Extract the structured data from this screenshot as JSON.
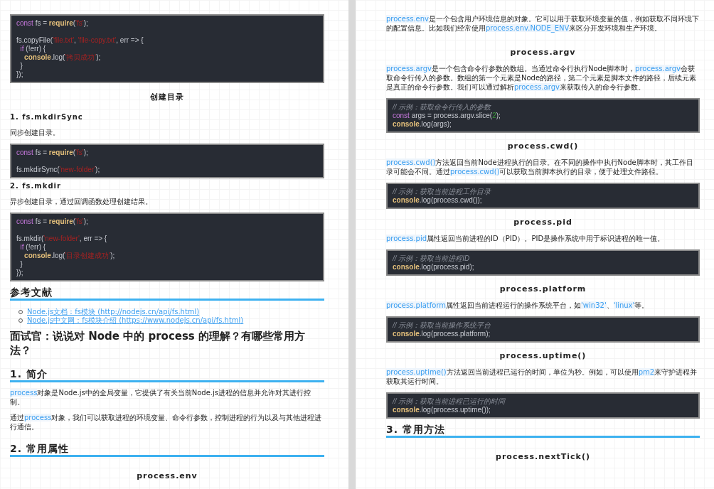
{
  "pages": [
    {
      "blocks": [
        {
          "kind": "code",
          "lines": [
            {
              "kind": "code",
              "tokens": [
                {
                  "kind": "kw",
                  "text": "const"
                },
                {
                  "kind": "plain",
                  "text": " fs = "
                },
                {
                  "kind": "fn",
                  "text": "require"
                },
                {
                  "kind": "plain",
                  "text": "("
                },
                {
                  "kind": "str",
                  "text": "'fs'"
                },
                {
                  "kind": "plain",
                  "text": ");"
                }
              ]
            },
            {
              "kind": "blank"
            },
            {
              "kind": "code",
              "tokens": [
                {
                  "kind": "plain",
                  "text": "fs.copyFile("
                },
                {
                  "kind": "str",
                  "text": "'file.txt'"
                },
                {
                  "kind": "plain",
                  "text": ", "
                },
                {
                  "kind": "str",
                  "text": "'file-copy.txt'"
                },
                {
                  "kind": "plain",
                  "text": ", err => {"
                }
              ]
            },
            {
              "kind": "code",
              "tokens": [
                {
                  "kind": "kw",
                  "text": "  if"
                },
                {
                  "kind": "plain",
                  "text": " (!err) {"
                }
              ]
            },
            {
              "kind": "code",
              "tokens": [
                {
                  "kind": "fn",
                  "text": "    console"
                },
                {
                  "kind": "plain",
                  "text": ".log("
                },
                {
                  "kind": "str",
                  "text": "'拷贝成功'"
                },
                {
                  "kind": "plain",
                  "text": ");"
                }
              ]
            },
            {
              "kind": "code",
              "tokens": [
                {
                  "kind": "plain",
                  "text": "  }"
                }
              ]
            },
            {
              "kind": "code",
              "tokens": [
                {
                  "kind": "plain",
                  "text": "});"
                }
              ]
            }
          ]
        },
        {
          "kind": "title",
          "text": "创建目录"
        },
        {
          "kind": "h4",
          "text": "1. fs.mkdirSync"
        },
        {
          "kind": "para",
          "segments": [
            {
              "kind": "text",
              "text": "同步创建目录。"
            }
          ]
        },
        {
          "kind": "code",
          "lines": [
            {
              "kind": "code",
              "tokens": [
                {
                  "kind": "kw",
                  "text": "const"
                },
                {
                  "kind": "plain",
                  "text": " fs = "
                },
                {
                  "kind": "fn",
                  "text": "require"
                },
                {
                  "kind": "plain",
                  "text": "("
                },
                {
                  "kind": "str",
                  "text": "'fs'"
                },
                {
                  "kind": "plain",
                  "text": ");"
                }
              ]
            },
            {
              "kind": "blank"
            },
            {
              "kind": "code",
              "tokens": [
                {
                  "kind": "plain",
                  "text": "fs.mkdirSync("
                },
                {
                  "kind": "str",
                  "text": "'new-folder'"
                },
                {
                  "kind": "plain",
                  "text": ");"
                }
              ]
            }
          ]
        },
        {
          "kind": "h4",
          "text": "2. fs.mkdir"
        },
        {
          "kind": "para",
          "segments": [
            {
              "kind": "text",
              "text": "异步创建目录，通过回调函数处理创建结果。"
            }
          ]
        },
        {
          "kind": "code",
          "lines": [
            {
              "kind": "code",
              "tokens": [
                {
                  "kind": "kw",
                  "text": "const"
                },
                {
                  "kind": "plain",
                  "text": " fs = "
                },
                {
                  "kind": "fn",
                  "text": "require"
                },
                {
                  "kind": "plain",
                  "text": "("
                },
                {
                  "kind": "str",
                  "text": "'fs'"
                },
                {
                  "kind": "plain",
                  "text": ");"
                }
              ]
            },
            {
              "kind": "blank"
            },
            {
              "kind": "code",
              "tokens": [
                {
                  "kind": "plain",
                  "text": "fs.mkdir("
                },
                {
                  "kind": "str",
                  "text": "'new-folder'"
                },
                {
                  "kind": "plain",
                  "text": ", err => {"
                }
              ]
            },
            {
              "kind": "code",
              "tokens": [
                {
                  "kind": "kw",
                  "text": "  if"
                },
                {
                  "kind": "plain",
                  "text": " (!err) {"
                }
              ]
            },
            {
              "kind": "code",
              "tokens": [
                {
                  "kind": "fn",
                  "text": "    console"
                },
                {
                  "kind": "plain",
                  "text": ".log("
                },
                {
                  "kind": "str",
                  "text": "'目录创建成功'"
                },
                {
                  "kind": "plain",
                  "text": ");"
                }
              ]
            },
            {
              "kind": "code",
              "tokens": [
                {
                  "kind": "plain",
                  "text": "  }"
                }
              ]
            },
            {
              "kind": "code",
              "tokens": [
                {
                  "kind": "plain",
                  "text": "});"
                }
              ]
            }
          ]
        },
        {
          "kind": "h2",
          "text": "参考文献"
        },
        {
          "kind": "links",
          "items": [
            "Node.js文档：fs模块 (http://nodejs.cn/api/fs.html)",
            "Node.js中文网：fs模块介绍 (https://www.nodejs.cn/api/fs.html)"
          ]
        },
        {
          "kind": "h1",
          "text": "面试官：说说对 Node 中的 process 的理解？有哪些常用方法？"
        },
        {
          "kind": "h2",
          "text": "1. 简介"
        },
        {
          "kind": "para",
          "segments": [
            {
              "kind": "code",
              "text": "process"
            },
            {
              "kind": "text",
              "text": "对象是Node.js中的全局变量，它提供了有关当前Node.js进程的信息并允许对其进行控制。"
            }
          ]
        },
        {
          "kind": "para",
          "segments": [
            {
              "kind": "text",
              "text": "通过"
            },
            {
              "kind": "code",
              "text": "process"
            },
            {
              "kind": "text",
              "text": "对象，我们可以获取进程的环境变量、命令行参数，控制进程的行为以及与其他进程进行通信。"
            }
          ]
        },
        {
          "kind": "h2",
          "text": "2. 常用属性"
        },
        {
          "kind": "title",
          "text": "process.env"
        }
      ]
    },
    {
      "blocks": [
        {
          "kind": "para",
          "segments": [
            {
              "kind": "code",
              "text": "process.env"
            },
            {
              "kind": "text",
              "text": "是一个包含用户环境信息的对象。它可以用于获取环境变量的值，例如获取不同环境下的配置信息。比如我们经常使用"
            },
            {
              "kind": "code",
              "text": "process.env.NODE_ENV"
            },
            {
              "kind": "text",
              "text": "来区分开发环境和生产环境。"
            }
          ]
        },
        {
          "kind": "title",
          "text": "process.argv"
        },
        {
          "kind": "para",
          "segments": [
            {
              "kind": "code",
              "text": "process.argv"
            },
            {
              "kind": "text",
              "text": "是一个包含命令行参数的数组。当通过命令行执行Node脚本时，"
            },
            {
              "kind": "code",
              "text": "process.argv"
            },
            {
              "kind": "text",
              "text": "会获取命令行传入的参数。数组的第一个元素是Node的路径，第二个元素是脚本文件的路径，后续元素是真正的命令行参数。我们可以通过解析"
            },
            {
              "kind": "code",
              "text": "process.argv"
            },
            {
              "kind": "text",
              "text": "来获取传入的命令行参数。"
            }
          ]
        },
        {
          "kind": "code",
          "lines": [
            {
              "kind": "code",
              "tokens": [
                {
                  "kind": "cm",
                  "text": "// 示例：获取命令行传入的参数"
                }
              ]
            },
            {
              "kind": "code",
              "tokens": [
                {
                  "kind": "kw",
                  "text": "const"
                },
                {
                  "kind": "plain",
                  "text": " args = process.argv.slice("
                },
                {
                  "kind": "num",
                  "text": "2"
                },
                {
                  "kind": "plain",
                  "text": ");"
                }
              ]
            },
            {
              "kind": "code",
              "tokens": [
                {
                  "kind": "fn",
                  "text": "console"
                },
                {
                  "kind": "plain",
                  "text": ".log(args);"
                }
              ]
            }
          ]
        },
        {
          "kind": "title",
          "text": "process.cwd()"
        },
        {
          "kind": "para",
          "segments": [
            {
              "kind": "code",
              "text": "process.cwd()"
            },
            {
              "kind": "text",
              "text": "方法返回当前Node进程执行的目录。在不同的操作中执行Node脚本时，其工作目录可能会不同。通过"
            },
            {
              "kind": "code",
              "text": "process.cwd()"
            },
            {
              "kind": "text",
              "text": "可以获取当前脚本执行的目录，便于处理文件路径。"
            }
          ]
        },
        {
          "kind": "code",
          "lines": [
            {
              "kind": "code",
              "tokens": [
                {
                  "kind": "cm",
                  "text": "// 示例：获取当前进程工作目录"
                }
              ]
            },
            {
              "kind": "code",
              "tokens": [
                {
                  "kind": "fn",
                  "text": "console"
                },
                {
                  "kind": "plain",
                  "text": ".log(process.cwd());"
                }
              ]
            }
          ]
        },
        {
          "kind": "title",
          "text": "process.pid"
        },
        {
          "kind": "para",
          "segments": [
            {
              "kind": "code",
              "text": "process.pid"
            },
            {
              "kind": "text",
              "text": "属性返回当前进程的ID（PID）。PID是操作系统中用于标识进程的唯一值。"
            }
          ]
        },
        {
          "kind": "code",
          "lines": [
            {
              "kind": "code",
              "tokens": [
                {
                  "kind": "cm",
                  "text": "// 示例：获取当前进程ID"
                }
              ]
            },
            {
              "kind": "code",
              "tokens": [
                {
                  "kind": "fn",
                  "text": "console"
                },
                {
                  "kind": "plain",
                  "text": ".log(process.pid);"
                }
              ]
            }
          ]
        },
        {
          "kind": "title",
          "text": "process.platform"
        },
        {
          "kind": "para",
          "segments": [
            {
              "kind": "code",
              "text": "process.platform"
            },
            {
              "kind": "text",
              "text": "属性返回当前进程运行的操作系统平台，如"
            },
            {
              "kind": "code",
              "text": "'win32'"
            },
            {
              "kind": "text",
              "text": "、"
            },
            {
              "kind": "code",
              "text": "'linux'"
            },
            {
              "kind": "text",
              "text": "等。"
            }
          ]
        },
        {
          "kind": "code",
          "lines": [
            {
              "kind": "code",
              "tokens": [
                {
                  "kind": "cm",
                  "text": "// 示例：获取当前操作系统平台"
                }
              ]
            },
            {
              "kind": "code",
              "tokens": [
                {
                  "kind": "fn",
                  "text": "console"
                },
                {
                  "kind": "plain",
                  "text": ".log(process.platform);"
                }
              ]
            }
          ]
        },
        {
          "kind": "title",
          "text": "process.uptime()"
        },
        {
          "kind": "para",
          "segments": [
            {
              "kind": "code",
              "text": "process.uptime()"
            },
            {
              "kind": "text",
              "text": "方法返回当前进程已运行的时间，单位为秒。例如，可以使用"
            },
            {
              "kind": "code",
              "text": "pm2"
            },
            {
              "kind": "text",
              "text": "来守护进程并获取其运行时间。"
            }
          ]
        },
        {
          "kind": "code",
          "lines": [
            {
              "kind": "code",
              "tokens": [
                {
                  "kind": "cm",
                  "text": "// 示例：获取当前进程已运行的时间"
                }
              ]
            },
            {
              "kind": "code",
              "tokens": [
                {
                  "kind": "fn",
                  "text": "console"
                },
                {
                  "kind": "plain",
                  "text": ".log(process.uptime());"
                }
              ]
            }
          ]
        },
        {
          "kind": "h2",
          "text": "3. 常用方法"
        },
        {
          "kind": "title",
          "text": "process.nextTick()"
        }
      ]
    }
  ]
}
